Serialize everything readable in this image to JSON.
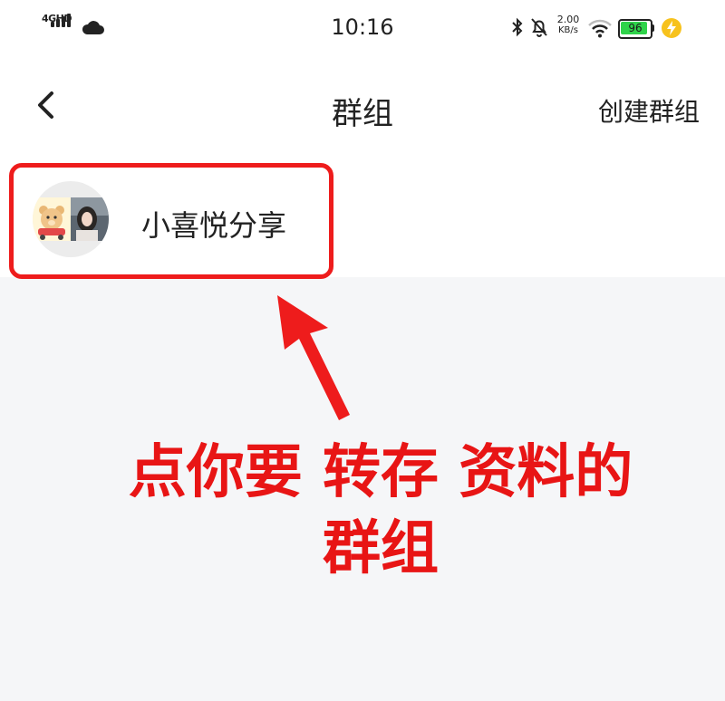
{
  "status_bar": {
    "network": "4GHD",
    "time": "10:16",
    "speed_value": "2.00",
    "speed_unit": "KB/s",
    "battery_percent": "96",
    "battery_level": 0.96,
    "battery_color": "#2fd34a",
    "icons": [
      "signal-icon",
      "cloud-icon",
      "bluetooth-icon",
      "bell-off-icon",
      "wifi-icon",
      "battery-icon",
      "charging-icon"
    ]
  },
  "header": {
    "back_icon": "chevron-left-icon",
    "title": "群组",
    "create_label": "创建群组"
  },
  "groups": [
    {
      "name": "小喜悦分享",
      "avatar": "group-avatar"
    }
  ],
  "annotation": {
    "line1": "点你要 转存 资料的",
    "line2": "群组",
    "color": "#e81515"
  }
}
